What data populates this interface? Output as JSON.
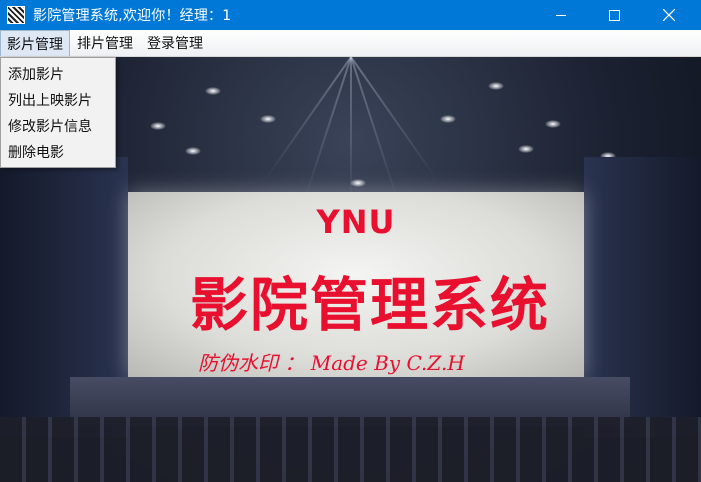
{
  "window": {
    "title": "影院管理系统,欢迎你！经理：1",
    "controls": {
      "minimize": "minimize",
      "maximize": "maximize",
      "close": "close"
    }
  },
  "menubar": {
    "items": [
      {
        "label": "影片管理"
      },
      {
        "label": "排片管理"
      },
      {
        "label": "登录管理"
      }
    ]
  },
  "dropdown": {
    "items": [
      {
        "label": "添加影片"
      },
      {
        "label": "列出上映影片"
      },
      {
        "label": "修改影片信息"
      },
      {
        "label": "删除电影"
      }
    ]
  },
  "background": {
    "brand": "YNU",
    "system_title": "影院管理系统",
    "watermark": "防伪水印 ： Made By C.Z.H",
    "accent_color": "#e8102e"
  }
}
